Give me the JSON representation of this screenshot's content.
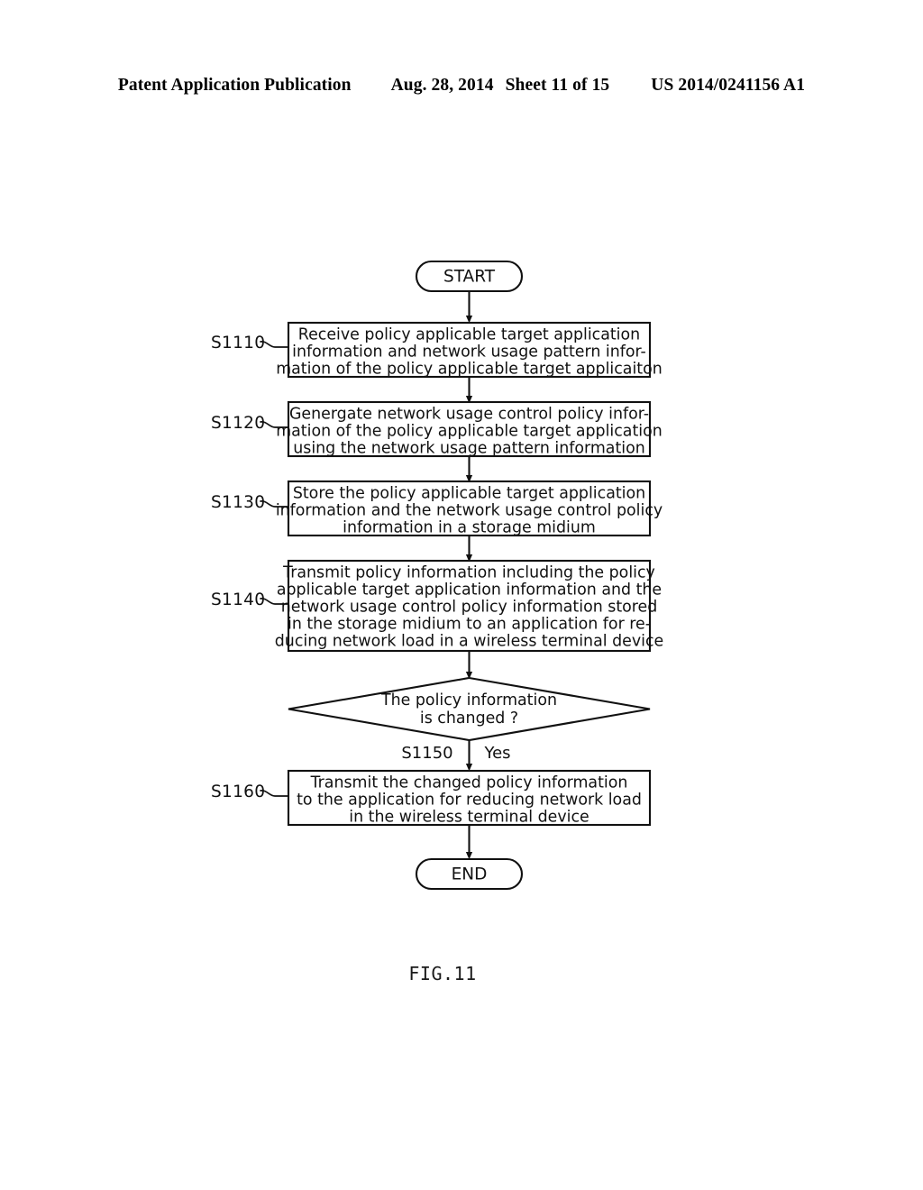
{
  "header": {
    "publication": "Patent Application Publication",
    "date": "Aug. 28, 2014",
    "sheet": "Sheet 11 of 15",
    "number": "US 2014/0241156 A1"
  },
  "figure": {
    "caption": "FIG.11",
    "type": "flowchart",
    "ink_color": "#111111",
    "background_color": "#ffffff"
  },
  "flowchart": {
    "start_label": "START",
    "end_label": "END",
    "branch_yes_label": "Yes",
    "decision_step_label": "S1150",
    "steps": [
      {
        "id": "S1110",
        "shape": "process",
        "lines": [
          "Receive policy applicable target application",
          "information and network usage pattern infor-",
          "mation of the policy applicable target applicaiton"
        ]
      },
      {
        "id": "S1120",
        "shape": "process",
        "lines": [
          "Genergate network usage control policy infor-",
          "mation of the policy applicable target application",
          "using the network usage pattern information"
        ]
      },
      {
        "id": "S1130",
        "shape": "process",
        "lines": [
          "Store the policy applicable target application",
          "information and the network usage control policy",
          "information in a storage midium"
        ]
      },
      {
        "id": "S1140",
        "shape": "process",
        "lines": [
          "Transmit policy information including the policy",
          "applicable target application information and the",
          "network usage control policy information stored",
          "in the storage midium to an application for re-",
          "ducing network load in a wireless terminal device"
        ]
      },
      {
        "id": "S1150",
        "shape": "decision",
        "lines": [
          "The policy information",
          "is changed ?"
        ]
      },
      {
        "id": "S1160",
        "shape": "process",
        "lines": [
          "Transmit the changed policy information",
          "to the application for reducing network load",
          "in the wireless terminal device"
        ]
      }
    ]
  }
}
